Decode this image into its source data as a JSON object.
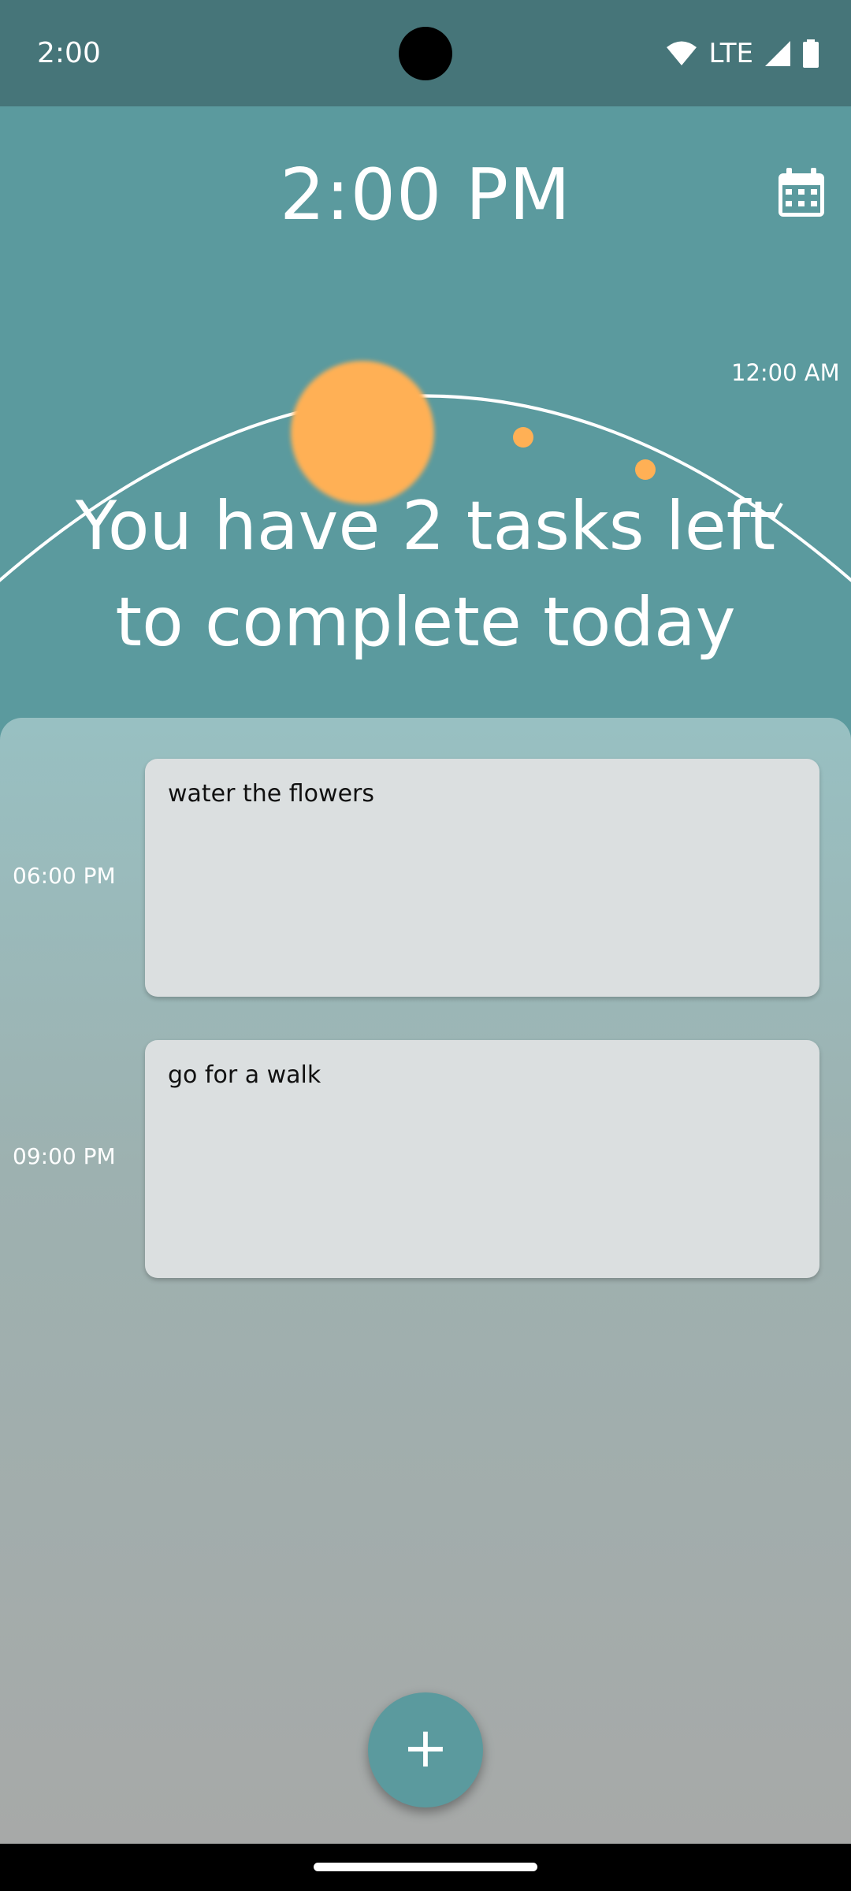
{
  "status_bar": {
    "time": "2:00",
    "network": "LTE"
  },
  "header": {
    "clock": "2:00 PM",
    "calendar_icon": "calendar-icon",
    "arc_label": "12:00 AM",
    "headline_line1": "You have 2 tasks left",
    "headline_line2": "to complete today"
  },
  "tasks": [
    {
      "time": "06:00 PM",
      "title": "water the flowers"
    },
    {
      "time": "09:00 PM",
      "title": "go for a walk"
    }
  ],
  "fab": {
    "label": "+",
    "icon": "plus-icon"
  },
  "colors": {
    "header_bg": "#5b9a9e",
    "status_bg": "#467579",
    "sun": "#ffb055",
    "card_bg": "#dbdfe0"
  }
}
